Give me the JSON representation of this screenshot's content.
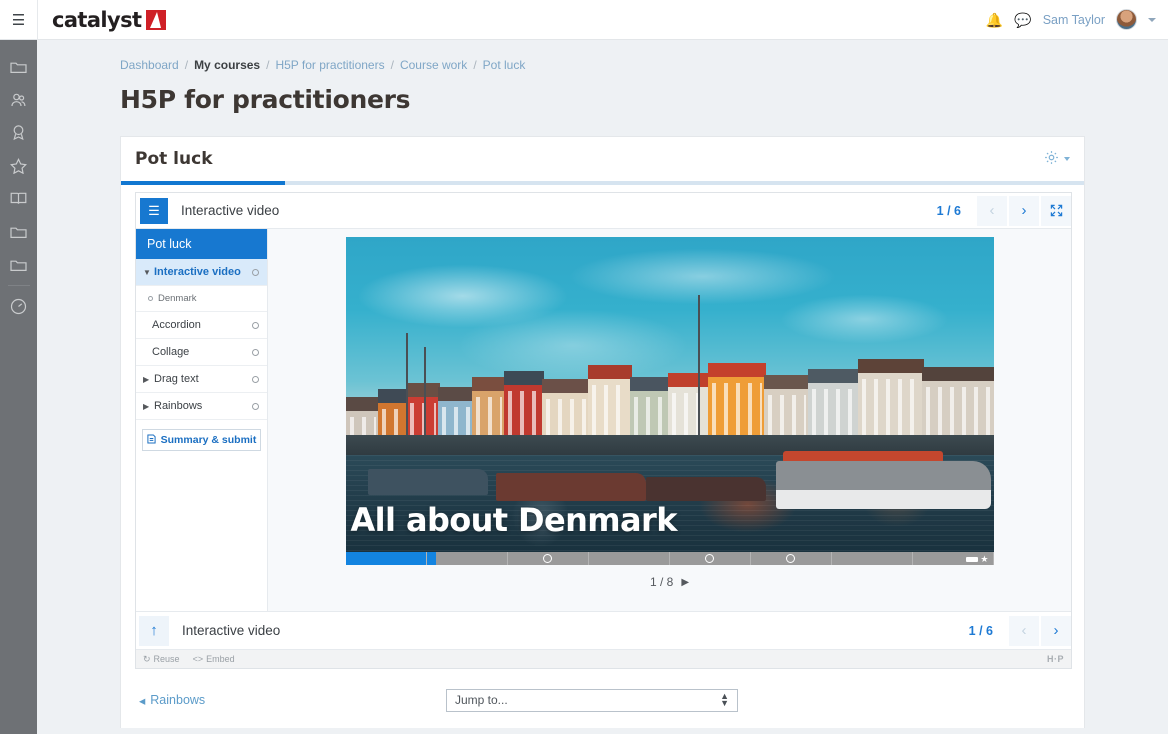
{
  "header": {
    "menu_icon": "hamburger-icon",
    "brand": "catalyst",
    "bell_icon": "bell-icon",
    "chat_icon": "chat-bubble-icon",
    "user_name": "Sam Taylor"
  },
  "rail": {
    "items": [
      {
        "icon": "folder-icon",
        "name": "sidebar-item-folder-1"
      },
      {
        "icon": "participants-icon",
        "name": "sidebar-item-participants"
      },
      {
        "icon": "badge-icon",
        "name": "sidebar-item-badges"
      },
      {
        "icon": "star-icon",
        "name": "sidebar-item-favourites"
      },
      {
        "icon": "book-icon",
        "name": "sidebar-item-book"
      },
      {
        "icon": "folder-icon",
        "name": "sidebar-item-folder-2"
      },
      {
        "icon": "folder-icon",
        "name": "sidebar-item-folder-3"
      },
      {
        "icon": "dashboard-icon",
        "name": "sidebar-item-dashboard"
      }
    ]
  },
  "breadcrumb": [
    {
      "label": "Dashboard",
      "current": false
    },
    {
      "label": "My courses",
      "current": true
    },
    {
      "label": "H5P for practitioners",
      "current": false
    },
    {
      "label": "Course work",
      "current": false
    },
    {
      "label": "Pot luck",
      "current": false
    }
  ],
  "page": {
    "title": "H5P for practitioners"
  },
  "card": {
    "title": "Pot luck",
    "gear_icon": "gear-icon",
    "progress_percent": 17
  },
  "h5p": {
    "menu_icon": "menu-icon",
    "title": "Interactive video",
    "counter": "1 / 6",
    "prev_icon": "chevron-left-icon",
    "next_icon": "chevron-right-icon",
    "fullscreen_icon": "fullscreen-icon",
    "nav_header": "Pot luck",
    "nav_items": [
      {
        "label": "Interactive video",
        "active": true,
        "tri": "▼",
        "status": true,
        "sub": false
      },
      {
        "label": "Denmark",
        "active": false,
        "tri": "",
        "status": false,
        "sub": true
      },
      {
        "label": "Accordion",
        "active": false,
        "tri": "",
        "status": true,
        "sub": false,
        "indent": true
      },
      {
        "label": "Collage",
        "active": false,
        "tri": "",
        "status": true,
        "sub": false,
        "indent": true
      },
      {
        "label": "Drag text",
        "active": false,
        "tri": "▶",
        "status": true,
        "sub": false
      },
      {
        "label": "Rainbows",
        "active": false,
        "tri": "▶",
        "status": true,
        "sub": false
      }
    ],
    "summary_button": "Summary & submit",
    "summary_icon": "document-icon",
    "video_title": "All about Denmark",
    "video_pager": "1 / 8",
    "video_pager_arrow": "play-arrow-icon",
    "bottom_title": "Interactive video",
    "bottom_counter": "1 / 6",
    "up_icon": "arrow-up-icon",
    "reuse_label": "Reuse",
    "reuse_icon": "reuse-icon",
    "embed_label": "Embed",
    "embed_icon": "code-icon",
    "logo": "H·P"
  },
  "footer": {
    "prev_label": "Rainbows",
    "prev_arrow": "◂",
    "jump_label": "Jump to..."
  },
  "colors": {
    "accent": "#1778d0",
    "brand_red": "#cf2027",
    "rail_bg": "#6e7175",
    "link": "#7fa6c6"
  }
}
